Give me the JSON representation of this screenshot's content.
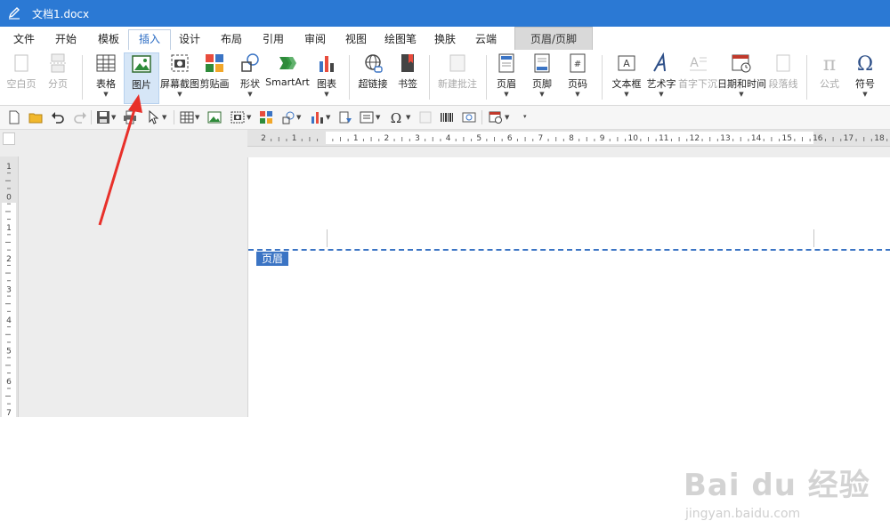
{
  "window": {
    "title": "文档1.docx"
  },
  "tabs": [
    {
      "label": "文件"
    },
    {
      "label": "开始"
    },
    {
      "label": "模板"
    },
    {
      "label": "插入",
      "active": true
    },
    {
      "label": "设计"
    },
    {
      "label": "布局"
    },
    {
      "label": "引用"
    },
    {
      "label": "审阅"
    },
    {
      "label": "视图"
    },
    {
      "label": "绘图笔"
    },
    {
      "label": "换肤"
    },
    {
      "label": "云端"
    },
    {
      "label": "页眉/页脚",
      "context": true
    }
  ],
  "ribbon": {
    "blank_page": "空白页",
    "page_break": "分页",
    "table": "表格",
    "picture": "图片",
    "screenshot": "屏幕截图",
    "clipart": "剪贴画",
    "shapes": "形状",
    "smartart": "SmartArt",
    "chart": "图表",
    "hyperlink": "超链接",
    "bookmark": "书签",
    "new_comment": "新建批注",
    "header": "页眉",
    "footer": "页脚",
    "page_number": "页码",
    "textbox": "文本框",
    "wordart": "艺术字",
    "drop_cap": "首字下沉",
    "date_time": "日期和时间",
    "signature_line": "段落线",
    "equation": "公式",
    "symbol": "符号"
  },
  "document": {
    "header_label": "页眉"
  },
  "ruler": {
    "h_ticks": [
      "2",
      "1",
      "",
      "1",
      "2",
      "3",
      "4",
      "5",
      "6",
      "7",
      "8",
      "9",
      "10",
      "11",
      "12",
      "13",
      "14",
      "15",
      "16",
      "17",
      "18"
    ],
    "v_ticks": [
      "1",
      "0",
      "1",
      "2",
      "3",
      "4",
      "5",
      "6",
      "7"
    ]
  },
  "watermark": {
    "logo": "Bai du 经验",
    "url": "jingyan.baidu.com"
  },
  "colors": {
    "titlebar": "#2b79d4",
    "accent": "#3b74c4",
    "arrow": "#e8302a"
  }
}
